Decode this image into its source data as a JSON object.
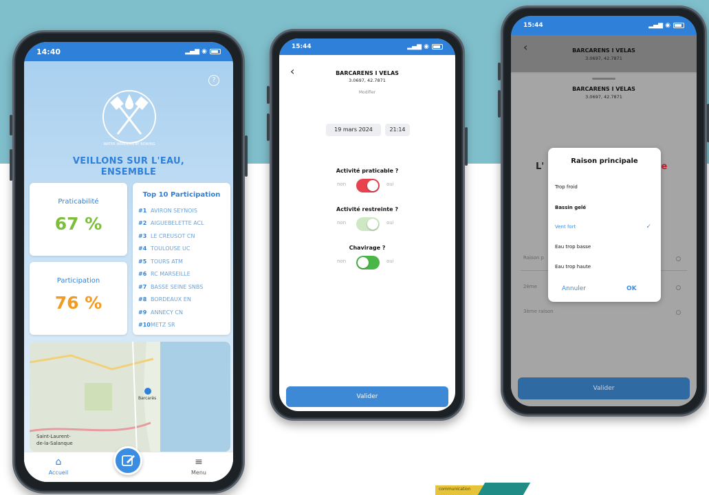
{
  "colors": {
    "background_top": "#7fbecb",
    "brand_blue": "#2f80d9",
    "green": "#7cbd3a",
    "orange": "#f39a22",
    "toggle_red": "#e8424f",
    "toggle_green": "#4bb648",
    "toggle_light_green": "#cfe8c4"
  },
  "phone1": {
    "status_time": "14:40",
    "help_icon": "question-circle-icon",
    "logo_text": "WATER WARDENS BY ROWING",
    "slogan_line1": "VEILLONS SUR L'EAU,",
    "slogan_line2": "ENSEMBLE",
    "praticabilite": {
      "title": "Praticabilité",
      "value": "67 %",
      "percent": 67
    },
    "participation": {
      "title": "Participation",
      "value": "76 %",
      "percent": 76
    },
    "top10": {
      "title": "Top 10 Participation",
      "items": [
        {
          "rank": "#1",
          "name": "AVIRON SEYNOIS"
        },
        {
          "rank": "#2",
          "name": "AIGUEBELETTE ACL"
        },
        {
          "rank": "#3",
          "name": "LE CREUSOT CN"
        },
        {
          "rank": "#4",
          "name": "TOULOUSE UC"
        },
        {
          "rank": "#5",
          "name": "TOURS ATM"
        },
        {
          "rank": "#6",
          "name": "RC MARSEILLE"
        },
        {
          "rank": "#7",
          "name": "BASSE SEINE SNBS"
        },
        {
          "rank": "#8",
          "name": "BORDEAUX EN"
        },
        {
          "rank": "#9",
          "name": "ANNECY CN"
        },
        {
          "rank": "#10",
          "name": "METZ SR"
        }
      ]
    },
    "map_label1": "Saint-Laurent-",
    "map_label2": "de-la-Salanque",
    "map_label3": "Barcarès",
    "tab_home": "Accueil",
    "tab_menu": "Menu",
    "home_icon": "home-icon",
    "menu_icon": "hamburger-menu-icon",
    "edit_icon": "edit-pencil-icon"
  },
  "phone2": {
    "status_time": "15:44",
    "header_title": "BARCARENS I VELAS",
    "header_coords": "3.0697, 42.7871",
    "header_link": "Modifier",
    "date": "19 mars 2024",
    "time": "21:14",
    "q1": "Activité praticable ?",
    "q2": "Activité restreinte ?",
    "q3": "Chavirage ?",
    "non": "non",
    "oui": "oui",
    "toggle1_on": true,
    "toggle2_on": false,
    "toggle3_on": true,
    "submit": "Valider"
  },
  "phone3": {
    "status_time": "15:44",
    "header_title": "BARCARENS I VELAS",
    "header_coords": "3.0697, 42.7871",
    "sheet_title": "BARCARENS I VELAS",
    "sheet_coords": "3.0697, 42.7871",
    "bg_letter_left": "L'",
    "bg_letter_right": "le",
    "dialog_title": "Raison principale",
    "options": [
      "Trop froid",
      "Bassin gelé",
      "Vent fort",
      "Eau trop basse",
      "Eau trop haute"
    ],
    "selected_option": "Vent fort",
    "cancel": "Annuler",
    "ok": "OK",
    "reason1": "Raison p",
    "reason2": "2ème",
    "reason3": "3ème raison",
    "submit": "Valider"
  },
  "decoration_text": "communication"
}
